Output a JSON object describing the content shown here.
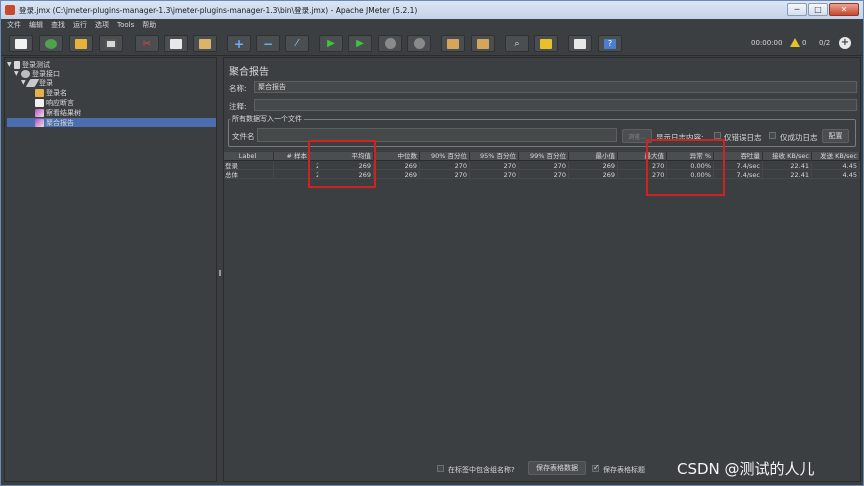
{
  "window": {
    "title": "登录.jmx (C:\\jmeter-plugins-manager-1.3\\jmeter-plugins-manager-1.3\\bin\\登录.jmx) - Apache JMeter (5.2.1)",
    "minimize": "─",
    "maximize": "□",
    "close": "✕"
  },
  "menu": [
    "文件",
    "编辑",
    "查找",
    "运行",
    "选项",
    "Tools",
    "帮助"
  ],
  "toolbar": {
    "timer": "00:00:00",
    "warn_count": "0",
    "thread_count": "0/2",
    "icons": [
      "new-icon",
      "templates-icon",
      "open-icon",
      "save-icon",
      "cut-icon",
      "copy-icon",
      "paste-icon",
      "expand-icon",
      "collapse-icon",
      "toggle-icon",
      "start-icon",
      "start-no-pause-icon",
      "stop-icon",
      "shutdown-icon",
      "clear-icon",
      "clear-all-icon",
      "search-icon",
      "reset-search-icon",
      "function-helper-icon",
      "help-icon"
    ]
  },
  "tree": {
    "items": [
      {
        "label": "登录测试",
        "icon": "testplan-icon"
      },
      {
        "label": "登录接口",
        "icon": "thread-group-icon"
      },
      {
        "label": "登录",
        "icon": "sampler-icon"
      },
      {
        "label": "登录名",
        "icon": "config-icon"
      },
      {
        "label": "响应断言",
        "icon": "assertion-icon"
      },
      {
        "label": "察看结果树",
        "icon": "listener-icon"
      },
      {
        "label": "聚合报告",
        "icon": "listener-icon"
      }
    ]
  },
  "panel": {
    "title": "聚合报告",
    "name_label": "名称:",
    "name_value": "聚合报告",
    "comment_label": "注释:",
    "comment_value": "",
    "file_group_label": "所有数据写入一个文件",
    "filename_label": "文件名",
    "filename_value": "",
    "browse_button": "浏览...",
    "log_label": "显示日志内容:",
    "errors_only_label": "仅错误日志",
    "success_only_label": "仅成功日志",
    "configure_button": "配置"
  },
  "table": {
    "columns": [
      "Label",
      "# 样本",
      "平均值",
      "中位数",
      "90% 百分位",
      "95% 百分位",
      "99% 百分位",
      "最小值",
      "最大值",
      "异常 %",
      "吞吐量",
      "接收 KB/sec",
      "发送 KB/sec"
    ],
    "rows": [
      [
        "登录",
        "2",
        "269",
        "269",
        "270",
        "270",
        "270",
        "269",
        "270",
        "0.00%",
        "7.4/sec",
        "22.41",
        "4.45"
      ],
      [
        "总体",
        "2",
        "269",
        "269",
        "270",
        "270",
        "270",
        "269",
        "270",
        "0.00%",
        "7.4/sec",
        "22.41",
        "4.45"
      ]
    ]
  },
  "bottom": {
    "include_group_label": "在标签中包含组名称?",
    "save_table_button": "保存表格数据",
    "save_header_label": "保存表格标题"
  },
  "watermark": "CSDN @测试的人儿",
  "colors": {
    "background": "#3c3f41",
    "selection": "#4b6eaf",
    "highlight": "#d12222"
  }
}
